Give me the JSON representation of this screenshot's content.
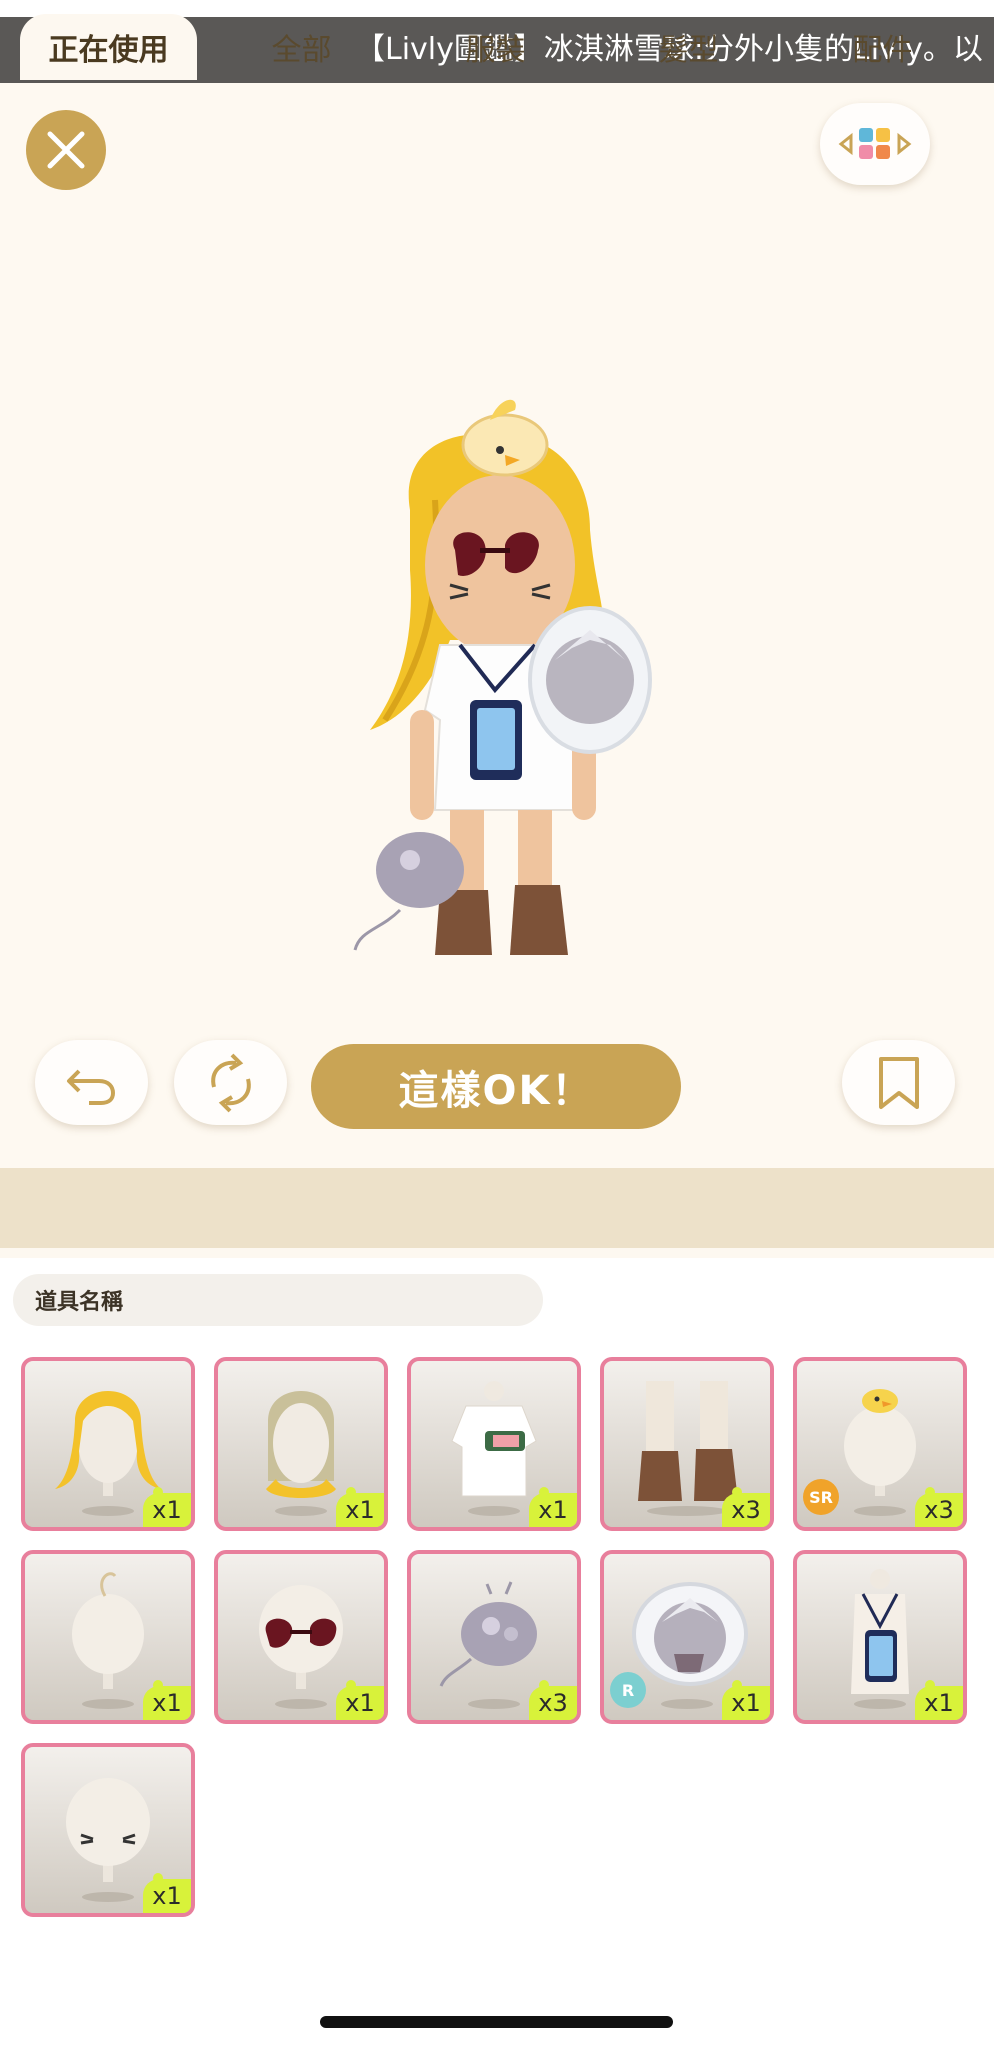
{
  "banner": {
    "text": "【Livly圖鑑】冰淇淋雪球:分外小隻的Livly。以"
  },
  "toolbar": {
    "ok_label": "這樣OK！"
  },
  "tabs": [
    {
      "label": "正在使用",
      "active": true
    },
    {
      "label": "全部",
      "active": false
    },
    {
      "label": "服裝",
      "active": false
    },
    {
      "label": "髮型",
      "active": false
    },
    {
      "label": "配件",
      "active": false
    }
  ],
  "search": {
    "placeholder": "道具名稱"
  },
  "items": [
    {
      "name": "yellow-long-hair-back",
      "qty": "x1"
    },
    {
      "name": "yellow-long-hair-front",
      "qty": "x1"
    },
    {
      "name": "white-tshirt",
      "qty": "x1"
    },
    {
      "name": "brown-paw-boots",
      "qty": "x3"
    },
    {
      "name": "chick-hat",
      "qty": "x3",
      "rarity": "SR"
    },
    {
      "name": "ahoge-hair",
      "qty": "x1"
    },
    {
      "name": "heart-sunglasses",
      "qty": "x1"
    },
    {
      "name": "purple-fluff-pet",
      "qty": "x3"
    },
    {
      "name": "character-fan",
      "qty": "x1",
      "rarity": "R"
    },
    {
      "name": "phone-lanyard",
      "qty": "x1"
    },
    {
      "name": "whisker-face",
      "qty": "x1"
    }
  ],
  "colors": {
    "accent": "#c9a455",
    "tile_border": "#e87f9c",
    "qty_badge": "#d8f23a",
    "rarity_sr": "#f0a32a",
    "rarity_r": "#7ccfd0"
  }
}
